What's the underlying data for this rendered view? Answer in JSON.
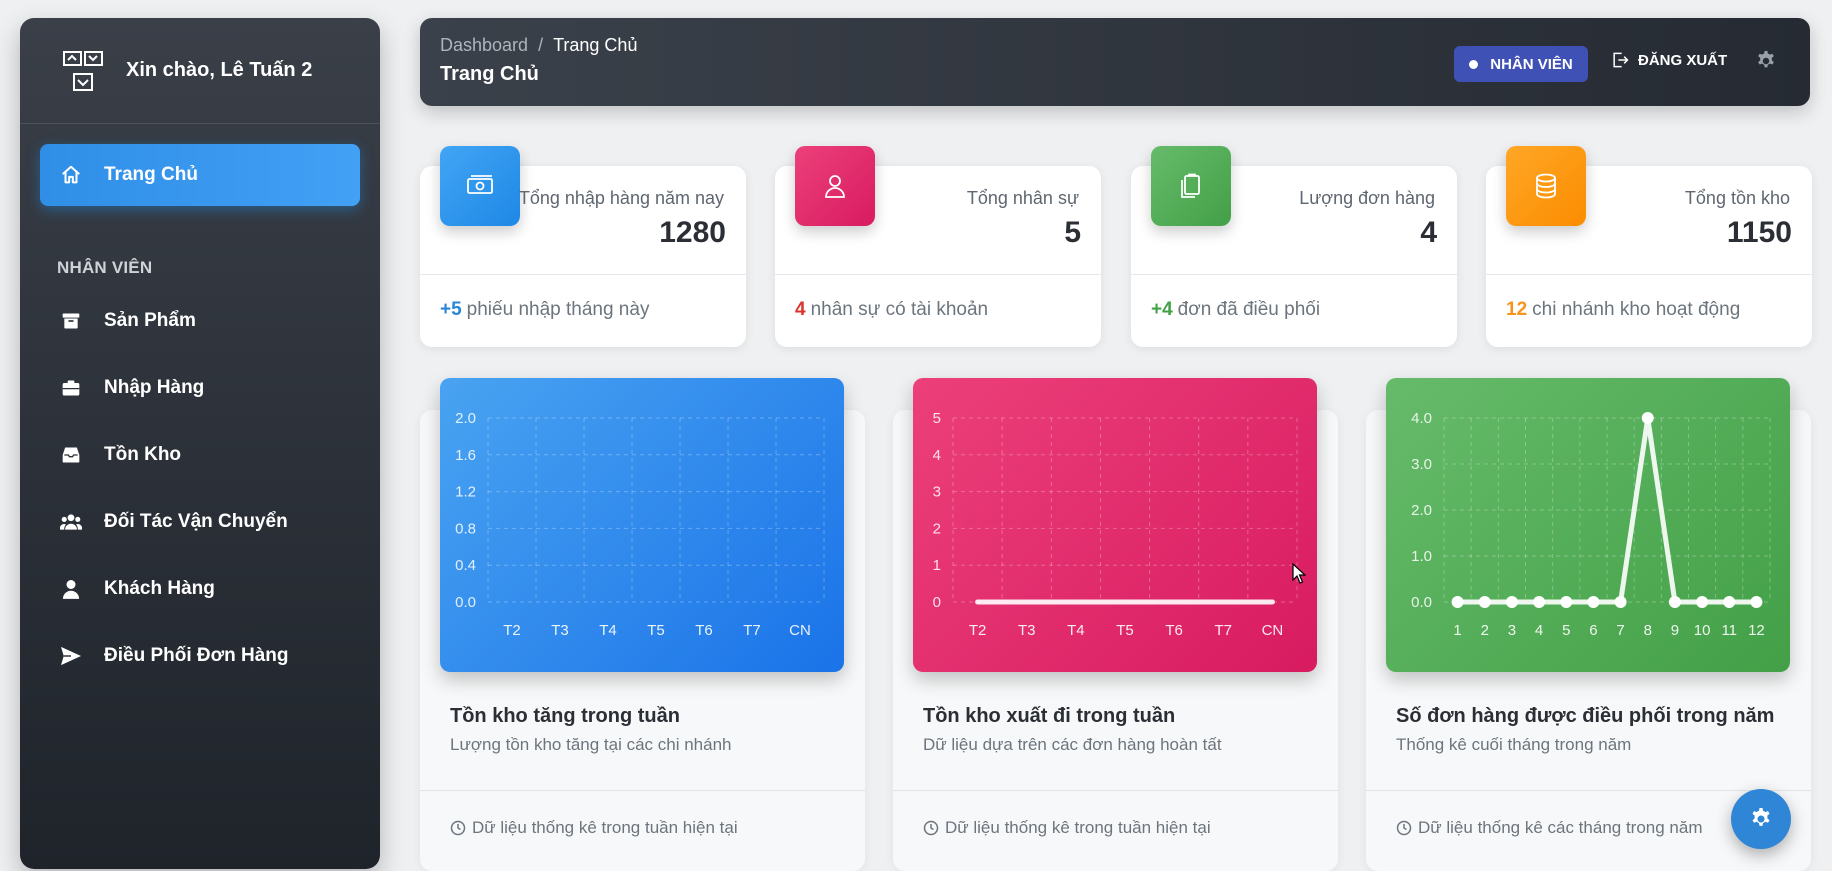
{
  "sidebar": {
    "greeting": "Xin chào, Lê Tuấn 2",
    "active_item": {
      "label": "Trang Chủ",
      "icon": "home-icon"
    },
    "section_title": "NHÂN VIÊN",
    "items": [
      {
        "label": "Sản Phẩm",
        "icon": "archive-icon"
      },
      {
        "label": "Nhập Hàng",
        "icon": "briefcase-icon"
      },
      {
        "label": "Tồn Kho",
        "icon": "inbox-icon"
      },
      {
        "label": "Đối Tác Vận Chuyển",
        "icon": "users-icon"
      },
      {
        "label": "Khách Hàng",
        "icon": "user-icon"
      },
      {
        "label": "Điều Phối Đơn Hàng",
        "icon": "send-icon"
      }
    ]
  },
  "header": {
    "breadcrumb_root": "Dashboard",
    "breadcrumb_sep": "/",
    "breadcrumb_current": "Trang Chủ",
    "title": "Trang Chủ",
    "role_badge": "NHÂN VIÊN",
    "logout": "ĐĂNG XUẤT"
  },
  "stats": [
    {
      "label": "Tổng nhập hàng năm nay",
      "value": "1280",
      "foot_num": "+5",
      "foot_text": "phiếu nhập tháng này",
      "color": "#2196f3",
      "num_color": "#2a85d8",
      "icon": "money-icon"
    },
    {
      "label": "Tổng nhân sự",
      "value": "5",
      "foot_num": "4",
      "foot_text": "nhân sự có tài khoản",
      "color": "#e91e63",
      "num_color": "#d8352f",
      "icon": "person-icon"
    },
    {
      "label": "Lượng đơn hàng",
      "value": "4",
      "foot_num": "+4",
      "foot_text": "đơn đã điều phối",
      "color": "#4caf50",
      "num_color": "#43a047",
      "icon": "clipboard-icon"
    },
    {
      "label": "Tổng tồn kho",
      "value": "1150",
      "foot_num": "12",
      "foot_text": "chi nhánh kho hoạt động",
      "color": "#ff9800",
      "num_color": "#f7941d",
      "icon": "database-icon"
    }
  ],
  "charts": [
    {
      "title": "Tồn kho tăng trong tuần",
      "subtitle": "Lượng tồn kho tăng tại các chi nhánh",
      "foot": "Dữ liệu thống kê trong tuần hiện tại"
    },
    {
      "title": "Tồn kho xuất đi trong tuần",
      "subtitle": "Dữ liệu dựa trên các đơn hàng hoàn tất",
      "foot": "Dữ liệu thống kê trong tuần hiện tại"
    },
    {
      "title": "Số đơn hàng được điều phối trong năm",
      "subtitle": "Thống kê cuối tháng trong năm",
      "foot": "Dữ liệu thống kê các tháng trong năm"
    }
  ],
  "chart_data": [
    {
      "type": "line",
      "categories": [
        "T2",
        "T3",
        "T4",
        "T5",
        "T6",
        "T7",
        "CN"
      ],
      "series": [
        {
          "values": []
        }
      ],
      "yticks": [
        "0.0",
        "0.4",
        "0.8",
        "1.2",
        "1.6",
        "2.0"
      ],
      "ylim": [
        0,
        2
      ],
      "grid": true,
      "background": "#2196f3"
    },
    {
      "type": "line",
      "categories": [
        "T2",
        "T3",
        "T4",
        "T5",
        "T6",
        "T7",
        "CN"
      ],
      "series": [
        {
          "values": [
            0,
            0,
            0,
            0,
            0,
            0,
            0
          ]
        }
      ],
      "yticks": [
        "0",
        "1",
        "2",
        "3",
        "4",
        "5"
      ],
      "ylim": [
        0,
        5
      ],
      "grid": true,
      "background": "#e91e63"
    },
    {
      "type": "line",
      "categories": [
        "1",
        "2",
        "3",
        "4",
        "5",
        "6",
        "7",
        "8",
        "9",
        "10",
        "11",
        "12"
      ],
      "series": [
        {
          "values": [
            0,
            0,
            0,
            0,
            0,
            0,
            0,
            4,
            0,
            0,
            0,
            0
          ]
        }
      ],
      "yticks": [
        "0.0",
        "1.0",
        "2.0",
        "3.0",
        "4.0"
      ],
      "ylim": [
        0,
        4
      ],
      "grid": true,
      "background": "#4caf50"
    }
  ]
}
